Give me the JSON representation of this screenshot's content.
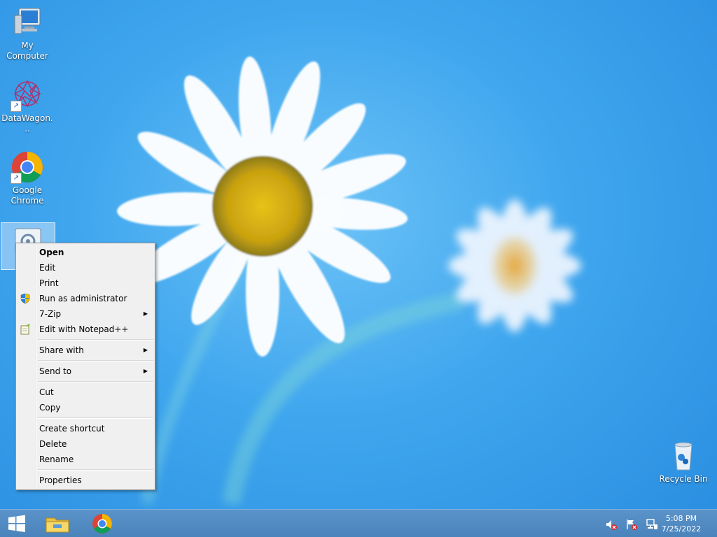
{
  "desktop": {
    "icons": [
      {
        "label": "My Computer",
        "icon": "computer-icon"
      },
      {
        "label": "DataWagon...",
        "icon": "datawagon-icon"
      },
      {
        "label": "Google Chrome",
        "icon": "chrome-icon"
      },
      {
        "label": "",
        "icon": "setup-icon"
      },
      {
        "label": "Recycle Bin",
        "icon": "recycle-bin-icon"
      }
    ]
  },
  "context_menu": {
    "items": [
      {
        "label": "Open",
        "bold": true
      },
      {
        "label": "Edit"
      },
      {
        "label": "Print"
      },
      {
        "label": "Run as administrator",
        "icon": "shield-icon"
      },
      {
        "label": "7-Zip",
        "submenu": true
      },
      {
        "label": "Edit with Notepad++",
        "icon": "notepad-plus-plus-icon"
      },
      {
        "label": "Share with",
        "submenu": true
      },
      {
        "label": "Send to",
        "submenu": true
      },
      {
        "label": "Cut"
      },
      {
        "label": "Copy"
      },
      {
        "label": "Create shortcut"
      },
      {
        "label": "Delete"
      },
      {
        "label": "Rename"
      },
      {
        "label": "Properties"
      }
    ]
  },
  "taskbar": {
    "start": "windows-logo-icon",
    "pinned": [
      "file-explorer-icon",
      "chrome-icon"
    ],
    "tray": [
      "speaker-muted-icon",
      "action-center-flag-icon",
      "network-icon"
    ],
    "clock": {
      "time": "5:08 PM",
      "date": "7/25/2022"
    }
  },
  "colors": {
    "taskbar": "#4a83bb",
    "menu_bg": "#f0f0f0",
    "wallpaper": "#3fa6ee"
  }
}
